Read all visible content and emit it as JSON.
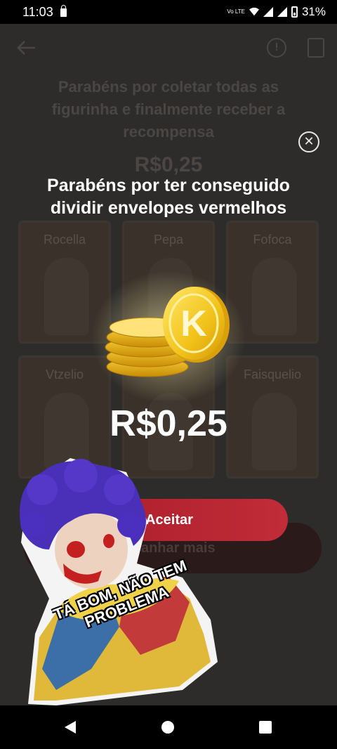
{
  "status_bar": {
    "time": "11:03",
    "volte": "Vo LTE",
    "battery": "31%"
  },
  "background_app": {
    "title": "Parabéns por coletar todas as figurinha e finalmente receber a recompensa",
    "amount": "R$0,25",
    "cards": [
      {
        "label": "Rocella"
      },
      {
        "label": "Pepa"
      },
      {
        "label": "Fofoca"
      },
      {
        "label": "Vtzelio"
      },
      {
        "label": ""
      },
      {
        "label": "Faisquelio"
      }
    ],
    "earn_more_button": "Ganhar mais"
  },
  "modal": {
    "title": "Parabéns por ter conseguido dividir envelopes vermelhos",
    "amount": "R$0,25",
    "coin_letter": "K",
    "accept_button": "Aceitar",
    "close_icon": "close-icon"
  },
  "sticker": {
    "text": "TÁ BOM, NÃO TEM PROBLEMA"
  },
  "colors": {
    "accept_button": "#b72533",
    "coin_gold": "#f2c21a",
    "overlay_bg": "#2c2b2b"
  }
}
